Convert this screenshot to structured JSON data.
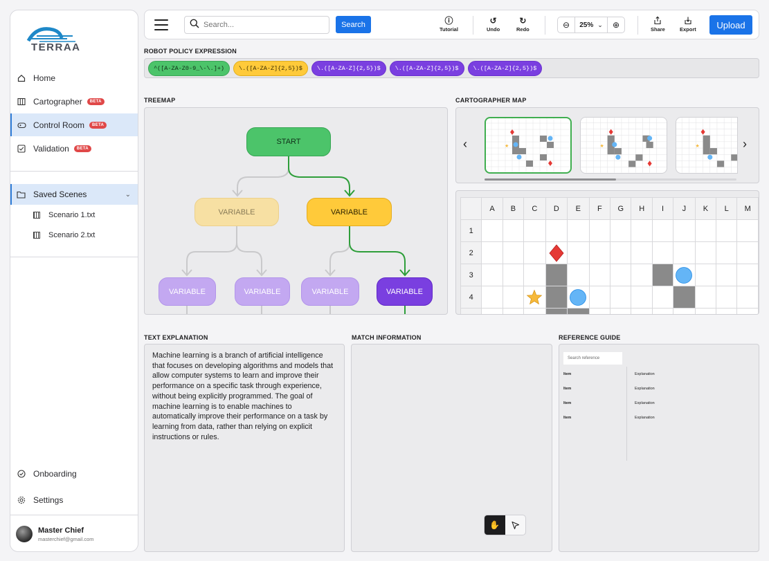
{
  "app": {
    "logo_text": "TERRAA"
  },
  "sidebar": {
    "items": [
      {
        "label": "Home",
        "icon": "home-icon",
        "beta": ""
      },
      {
        "label": "Cartographer",
        "icon": "map-icon",
        "beta": "BETA"
      },
      {
        "label": "Control Room",
        "icon": "gamepad-icon",
        "beta": "BETA"
      },
      {
        "label": "Validation",
        "icon": "checkbox-icon",
        "beta": "BETA"
      }
    ],
    "saved_scenes": {
      "label": "Saved Scenes",
      "files": [
        "Scenario 1.txt",
        "Scenario 2.txt"
      ]
    },
    "bottom": [
      {
        "label": "Onboarding",
        "icon": "check-circle-icon"
      },
      {
        "label": "Settings",
        "icon": "gear-icon"
      }
    ],
    "user": {
      "name": "Master Chief",
      "email": "masterchief@gmail.com"
    }
  },
  "toolbar": {
    "search_placeholder": "Search...",
    "search_label": "Search",
    "tutorial_label": "Tutorial",
    "undo_label": "Undo",
    "redo_label": "Redo",
    "zoom_value": "25%",
    "share_label": "Share",
    "export_label": "Export",
    "upload_label": "Upload"
  },
  "policy": {
    "title": "ROBOT POLICY EXPRESSION",
    "pills": [
      {
        "text": "^([A-ZA-Z0-9_\\-\\.]+)",
        "bg": "#4cc46a",
        "fg": "#0f2d16",
        "border": "#3aa656"
      },
      {
        "text": "\\.([A-ZA-Z]{2,5})$",
        "bg": "#ffca3a",
        "fg": "#3a2d00",
        "border": "#e0ad1e"
      },
      {
        "text": "\\.([A-ZA-Z]{2,5})$",
        "bg": "#7a3fe0",
        "fg": "#ffffff",
        "border": "#6a31cf"
      },
      {
        "text": "\\.([A-ZA-Z]{2,5})$",
        "bg": "#7a3fe0",
        "fg": "#ffffff",
        "border": "#6a31cf"
      },
      {
        "text": "\\.([A-ZA-Z]{2,5})$",
        "bg": "#7a3fe0",
        "fg": "#ffffff",
        "border": "#6a31cf"
      }
    ]
  },
  "treemap": {
    "title": "TREEMAP",
    "start_label": "START",
    "variable_label": "VARIABLE"
  },
  "cartographer": {
    "title": "CARTOGRAPHER MAP",
    "columns": [
      "A",
      "B",
      "C",
      "D",
      "E",
      "F",
      "G",
      "H",
      "I",
      "J",
      "K",
      "L",
      "M"
    ],
    "rows": [
      "1",
      "2",
      "3",
      "4"
    ]
  },
  "text_explanation": {
    "title": "TEXT EXPLANATION",
    "body": "Machine learning is a branch of artificial intelligence that focuses on developing algorithms and models that allow computer systems to learn and improve their performance on a specific task through experience, without being explicitly programmed. The goal of machine learning is to enable machines to automatically improve their performance on a task by learning from data, rather than relying on explicit instructions or rules."
  },
  "match_information": {
    "title": "MATCH INFORMATION"
  },
  "reference_guide": {
    "title": "REFERENCE GUIDE",
    "search_placeholder": "Search reference",
    "rows": [
      {
        "item": "Item",
        "explanation": "Explanation"
      },
      {
        "item": "Item",
        "explanation": "Explanation"
      },
      {
        "item": "Item",
        "explanation": "Explanation"
      },
      {
        "item": "Item",
        "explanation": "Explanation"
      }
    ]
  },
  "colors": {
    "accent": "#1a73e8",
    "green": "#4cc46a",
    "yellow": "#ffca3a",
    "purple": "#7a3fe0",
    "wall": "#8a8a8a",
    "diamond": "#e53935",
    "circle": "#64b5f6",
    "star": "#f6b93b"
  }
}
